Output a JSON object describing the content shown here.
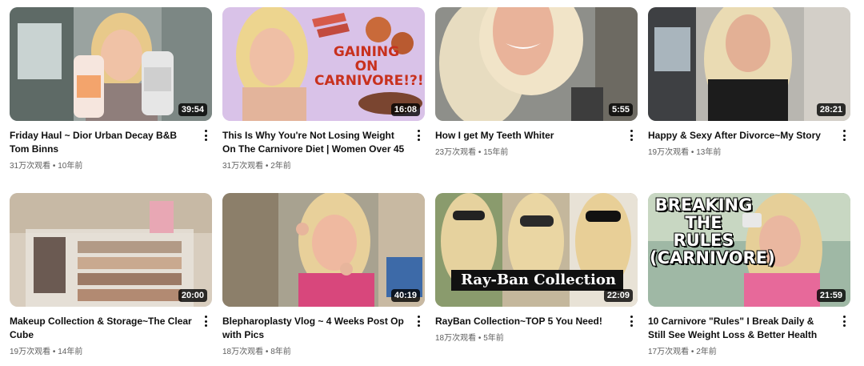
{
  "videos": [
    {
      "title": "Friday Haul ~ Dior Urban Decay B&B Tom Binns",
      "views": "31万次观看",
      "age": "10年前",
      "duration": "39:54"
    },
    {
      "title": "This Is Why You're Not Losing Weight On The Carnivore Diet | Women Over 45",
      "views": "31万次观看",
      "age": "2年前",
      "duration": "16:08",
      "overlay": "GAINING\nON\nCARNIVORE!?!"
    },
    {
      "title": "How I get My Teeth Whiter",
      "views": "23万次观看",
      "age": "15年前",
      "duration": "5:55"
    },
    {
      "title": "Happy & Sexy After Divorce~My Story",
      "views": "19万次观看",
      "age": "13年前",
      "duration": "28:21"
    },
    {
      "title": "Makeup Collection & Storage~The Clear Cube",
      "views": "19万次观看",
      "age": "14年前",
      "duration": "20:00"
    },
    {
      "title": "Blepharoplasty Vlog ~ 4 Weeks Post Op with Pics",
      "views": "18万次观看",
      "age": "8年前",
      "duration": "40:19"
    },
    {
      "title": "RayBan Collection~TOP 5 You Need!",
      "views": "18万次观看",
      "age": "5年前",
      "duration": "22:09",
      "overlay": "Ray-Ban Collection"
    },
    {
      "title": "10 Carnivore \"Rules\" I Break Daily & Still See Weight Loss & Better Health",
      "views": "17万次观看",
      "age": "2年前",
      "duration": "21:59",
      "overlay": "BREAKING\nTHE\nRULES\n(CARNIVORE)"
    }
  ],
  "separator": "•"
}
